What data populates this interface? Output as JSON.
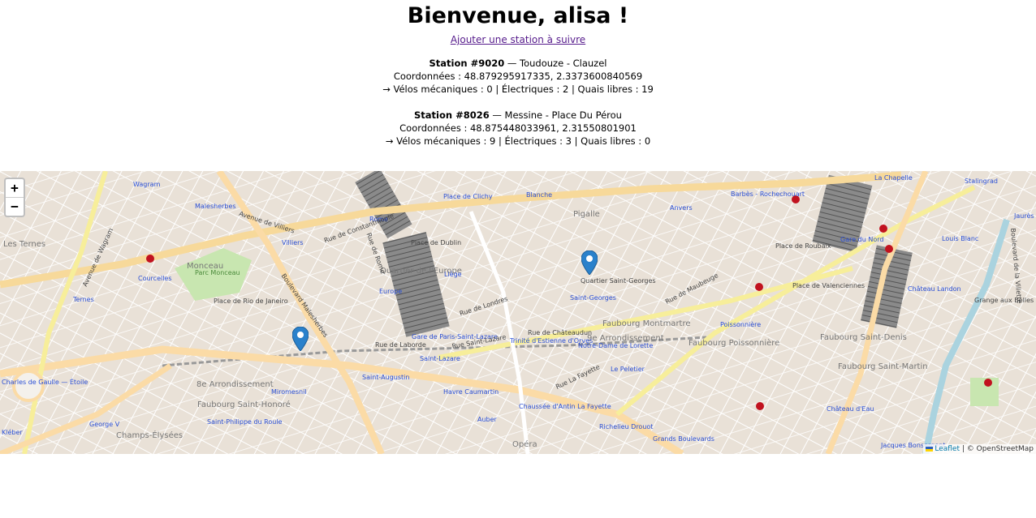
{
  "header": {
    "title": "Bienvenue, alisa !",
    "add_link": "Ajouter une station à suivre"
  },
  "stations": [
    {
      "title": "Station #9020",
      "name": " — Toudouze - Clauzel",
      "coords": "Coordonnées : 48.879295917335, 2.3373600840569",
      "bikes": "→ Vélos mécaniques : 0 | Électriques : 2 | Quais libres : 19"
    },
    {
      "title": "Station #8026",
      "name": " — Messine - Place Du Pérou",
      "coords": "Coordonnées : 48.875448033961, 2.31550801901",
      "bikes": "→ Vélos mécaniques : 9 | Électriques : 3 | Quais libres : 0"
    }
  ],
  "map": {
    "zoom_in": "+",
    "zoom_out": "−",
    "attribution_link": "Leaflet",
    "attribution_rest": " | © OpenStreetMap",
    "labels": {
      "wagram": "Wagram",
      "malesherbes": "Malesherbes",
      "rome": "Rome",
      "place_de_clichy": "Place de Clichy",
      "blanche": "Blanche",
      "pigalle": "Pigalle",
      "anvers": "Anvers",
      "barbes": "Barbès - Rochechouart",
      "la_chapelle": "La Chapelle",
      "stalingrad": "Stalingrad",
      "les_ternes": "Les Ternes",
      "monceau": "Monceau",
      "parc_monceau": "Parc Monceau",
      "courcelles": "Courcelles",
      "villiers": "Villiers",
      "quartier_europe": "Quartier de l'Europe",
      "europe": "Europe",
      "liege": "Liège",
      "place_de_dublin": "Place de Dublin",
      "quartier_saint_georges": "Quartier Saint-Georges",
      "saint_georges": "Saint-Georges",
      "faubourg_montmartre": "Faubourg Montmartre",
      "ixe_arrondissement": "9e Arrondissement",
      "faubourg_poissonniere": "Faubourg Poissonnière",
      "poissonniere": "Poissonnière",
      "place_de_roubaix": "Place de Roubaix",
      "gare_du_nord": "Gare du Nord",
      "louis_blanc": "Louis Blanc",
      "jaures": "Jaurès",
      "chateau_landon": "Château Landon",
      "grange_aux_belles": "Grange aux Belles",
      "place_de_valenciennes": "Place de Valenciennes",
      "faubourg_saint_denis": "Faubourg Saint-Denis",
      "faubourg_saint_martin": "Faubourg Saint-Martin",
      "chateau_deau": "Château d'Eau",
      "ternes": "Ternes",
      "place_rio": "Place de Rio de Janeiro",
      "gare_saint_lazare": "Gare de Paris-Saint-Lazare",
      "saint_lazare": "Saint-Lazare",
      "trinite": "Trinité d'Estienne d'Orves",
      "notre_dame_lorette": "Notre-Dame de Lorette",
      "le_peletier": "Le Peletier",
      "charles_de_gaulle": "Charles de Gaulle — Étoile",
      "viiie_arrondissement": "8e Arrondissement",
      "miromesnil": "Miromesnil",
      "saint_augustin": "Saint-Augustin",
      "havre_caumartin": "Havre Caumartin",
      "auber": "Auber",
      "chaussee_antin": "Chaussée d'Antin La Fayette",
      "opera": "Opéra",
      "richelieu_drouot": "Richelieu Drouot",
      "grands_boulevards": "Grands Boulevards",
      "faubourg_saint_honore": "Faubourg Saint-Honoré",
      "saint_philippe": "Saint-Philippe du Roule",
      "george_v": "George V",
      "champs_elysees": "Champs-Élysées",
      "kleber": "Kléber",
      "jacques_bonsergent": "Jacques Bonsergent",
      "bd_malesherbes": "Boulevard Malesherbes",
      "bd_haussmann": "Boulevard Haussmann",
      "bd_magenta": "Boulevard de Magenta",
      "rue_de_maubeuge": "Rue de Maubeuge",
      "rue_la_fayette": "Rue La Fayette",
      "rue_de_chateaudun": "Rue de Châteaudun",
      "rue_saint_lazare": "Rue Saint-Lazare",
      "rue_de_londres": "Rue de Londres",
      "rue_de_rome": "Rue de Rome",
      "avenue_de_villiers": "Avenue de Villiers",
      "avenue_de_wagram": "Avenue de Wagram",
      "bd_de_la_villette": "Boulevard de la Villette",
      "rue_de_constantinople": "Rue de Constantinople",
      "rue_de_laborde": "Rue de Laborde"
    }
  }
}
